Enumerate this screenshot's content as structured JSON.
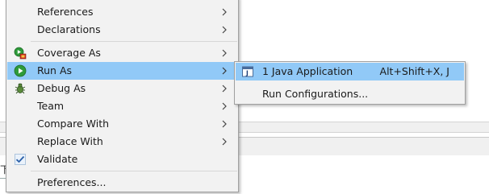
{
  "background": {
    "fragment_text": "下"
  },
  "menu": {
    "items": [
      {
        "label": "References",
        "has_submenu": true,
        "icon": ""
      },
      {
        "label": "Declarations",
        "has_submenu": true,
        "icon": ""
      },
      {
        "label": "Coverage As",
        "has_submenu": true,
        "icon": "coverage-icon"
      },
      {
        "label": "Run As",
        "has_submenu": true,
        "icon": "run-icon",
        "highlighted": true
      },
      {
        "label": "Debug As",
        "has_submenu": true,
        "icon": "debug-bug-icon"
      },
      {
        "label": "Team",
        "has_submenu": true,
        "icon": ""
      },
      {
        "label": "Compare With",
        "has_submenu": true,
        "icon": ""
      },
      {
        "label": "Replace With",
        "has_submenu": true,
        "icon": ""
      },
      {
        "label": "Validate",
        "has_submenu": false,
        "icon": "checkmark-icon"
      },
      {
        "label": "Preferences...",
        "has_submenu": false,
        "icon": ""
      }
    ]
  },
  "submenu": {
    "items": [
      {
        "label": "1 Java Application",
        "shortcut": "Alt+Shift+X, J",
        "icon": "java-application-icon",
        "highlighted": true
      },
      {
        "label": "Run Configurations...",
        "shortcut": "",
        "icon": ""
      }
    ]
  },
  "colors": {
    "highlight": "#91c9f7",
    "menu_background": "#f2f2f2",
    "run_green": "#2e9b3a"
  }
}
